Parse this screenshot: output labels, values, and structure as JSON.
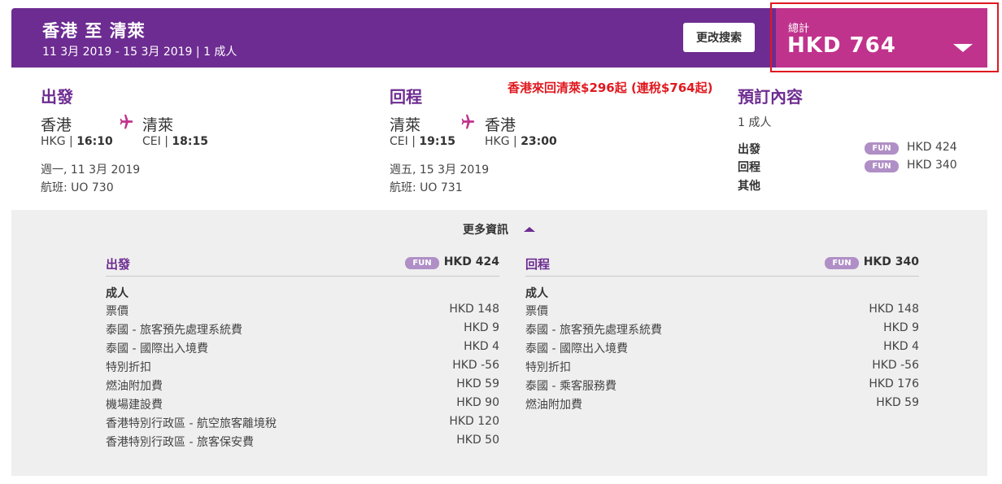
{
  "header": {
    "route": "香港 至 清萊",
    "dates": "11 3月 2019 - 15 3月 2019 | 1 成人",
    "modify_label": "更改搜索"
  },
  "total": {
    "label": "總計",
    "amount": "HKD 764"
  },
  "promo": "香港來回清萊$296起 (連稅$764起)",
  "outbound": {
    "title": "出發",
    "from_city": "香港",
    "to_city": "清萊",
    "from_code": "HKG",
    "from_time": "16:10",
    "to_code": "CEI",
    "to_time": "18:15",
    "date": "週一, 11 3月 2019",
    "flight": "航班: UO 730"
  },
  "inbound": {
    "title": "回程",
    "from_city": "清萊",
    "to_city": "香港",
    "from_code": "CEI",
    "from_time": "19:15",
    "to_code": "HKG",
    "to_time": "23:00",
    "date": "週五, 15 3月 2019",
    "flight": "航班: UO 731"
  },
  "summary": {
    "title": "預訂內容",
    "pax": "1 成人",
    "rows": [
      {
        "label": "出發",
        "badge": "FUN",
        "amount": "HKD 424"
      },
      {
        "label": "回程",
        "badge": "FUN",
        "amount": "HKD 340"
      },
      {
        "label": "其他"
      }
    ]
  },
  "details": {
    "toggle_label": "更多資訊",
    "outbound": {
      "title": "出發",
      "badge": "FUN",
      "amount": "HKD 424",
      "pax": "成人",
      "items": [
        {
          "name": "票價",
          "amount": "HKD 148"
        },
        {
          "name": "泰國 - 旅客預先處理系統費",
          "amount": "HKD 9"
        },
        {
          "name": "泰國 - 國際出入境費",
          "amount": "HKD 4"
        },
        {
          "name": "特別折扣",
          "amount": "HKD -56"
        },
        {
          "name": "燃油附加費",
          "amount": "HKD 59"
        },
        {
          "name": "機場建設費",
          "amount": "HKD 90"
        },
        {
          "name": "香港特別行政區 - 航空旅客離境稅",
          "amount": "HKD 120"
        },
        {
          "name": "香港特別行政區 - 旅客保安費",
          "amount": "HKD 50"
        }
      ]
    },
    "inbound": {
      "title": "回程",
      "badge": "FUN",
      "amount": "HKD 340",
      "pax": "成人",
      "items": [
        {
          "name": "票價",
          "amount": "HKD 148"
        },
        {
          "name": "泰國 - 旅客預先處理系統費",
          "amount": "HKD 9"
        },
        {
          "name": "泰國 - 國際出入境費",
          "amount": "HKD 4"
        },
        {
          "name": "特別折扣",
          "amount": "HKD -56"
        },
        {
          "name": "泰國 - 乘客服務費",
          "amount": "HKD 176"
        },
        {
          "name": "燃油附加費",
          "amount": "HKD 59"
        }
      ]
    }
  },
  "colors": {
    "brand_purple": "#6d2c91",
    "magenta": "#c0338d",
    "promo_red": "#e0191f",
    "badge": "#b08fc6"
  },
  "icons": {
    "plane": "airplane-icon",
    "caret_down": "chevron-down-icon",
    "caret_up": "chevron-up-icon"
  }
}
